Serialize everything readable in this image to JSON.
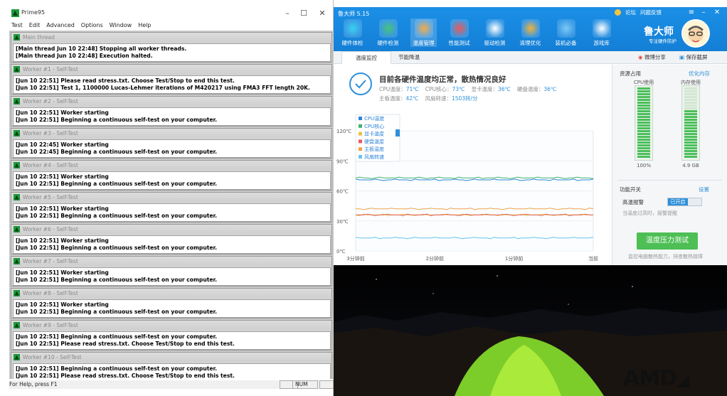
{
  "prime": {
    "title": "Prime95",
    "menu": [
      "Test",
      "Edit",
      "Advanced",
      "Options",
      "Window",
      "Help"
    ],
    "windows": [
      {
        "title": "Main thread",
        "lines": [
          "[Main thread Jun 10 22:48] Stopping all worker threads.",
          "[Main thread Jun 10 22:48] Execution halted."
        ]
      },
      {
        "title": "Worker #1 - Self-Test",
        "lines": [
          "[Jun 10 22:51] Please read stress.txt.  Choose Test/Stop to end this test.",
          "[Jun 10 22:51] Test 1, 1100000 Lucas-Lehmer iterations of M420217 using FMA3 FFT length 20K."
        ]
      },
      {
        "title": "Worker #2 - Self-Test",
        "lines": [
          "[Jun 10 22:51] Worker starting",
          "[Jun 10 22:51] Beginning a continuous self-test on your computer."
        ]
      },
      {
        "title": "Worker #3 - Self-Test",
        "lines": [
          "[Jun 10 22:45] Worker starting",
          "[Jun 10 22:45] Beginning a continuous self-test on your computer."
        ]
      },
      {
        "title": "Worker #4 - Self-Test",
        "lines": [
          "[Jun 10 22:51] Worker starting",
          "[Jun 10 22:51] Beginning a continuous self-test on your computer."
        ]
      },
      {
        "title": "Worker #5 - Self-Test",
        "lines": [
          "[Jun 10 22:51] Worker starting",
          "[Jun 10 22:51] Beginning a continuous self-test on your computer."
        ]
      },
      {
        "title": "Worker #6 - Self-Test",
        "lines": [
          "[Jun 10 22:51] Worker starting",
          "[Jun 10 22:51] Beginning a continuous self-test on your computer."
        ]
      },
      {
        "title": "Worker #7 - Self-Test",
        "lines": [
          "[Jun 10 22:51] Worker starting",
          "[Jun 10 22:51] Beginning a continuous self-test on your computer."
        ]
      },
      {
        "title": "Worker #8 - Self-Test",
        "lines": [
          "[Jun 10 22:51] Worker starting",
          "[Jun 10 22:51] Beginning a continuous self-test on your computer."
        ]
      },
      {
        "title": "Worker #9 - Self-Test",
        "lines": [
          "[Jun 10 22:51] Beginning a continuous self-test on your computer.",
          "[Jun 10 22:51] Please read stress.txt.  Choose Test/Stop to end this test."
        ]
      },
      {
        "title": "Worker #10 - Self-Test",
        "lines": [
          "[Jun 10 22:51] Beginning a continuous self-test on your computer.",
          "[Jun 10 22:51] Please read stress.txt.  Choose Test/Stop to end this test."
        ]
      }
    ],
    "status_help": "For Help, press F1",
    "status_num": "NUM"
  },
  "lds": {
    "title": "鲁大师 5.15",
    "tabs": [
      "硬件体检",
      "硬件检测",
      "温度管理",
      "性能测试",
      "驱动检测",
      "清理优化",
      "装机必备",
      "游戏库"
    ],
    "active_tab": 2,
    "top_links": [
      "论坛",
      "问题反馈"
    ],
    "brand": "鲁大师",
    "slogan": "专注硬件防护",
    "subtabs": [
      "温度监控",
      "节能降温"
    ],
    "share": "微博分享",
    "save": "保存截屏",
    "status_main": "目前各硬件温度均正常，散热情况良好",
    "stats_row1": [
      {
        "label": "CPU温度：",
        "value": "71℃"
      },
      {
        "label": "CPU核心：",
        "value": "73℃"
      },
      {
        "label": "显卡温度：",
        "value": "36℃"
      },
      {
        "label": "硬盘温度：",
        "value": "36℃"
      }
    ],
    "stats_row2": [
      {
        "label": "主板温度：",
        "value": "42℃"
      },
      {
        "label": "风扇转速：",
        "value": "1503转/分"
      }
    ],
    "right": {
      "resource_title": "资源占用",
      "optimize_link": "优化内存",
      "cpu_label": "CPU使用",
      "cpu_value": "100%",
      "cpu_level": 1.0,
      "mem_label": "内存使用",
      "mem_value": "4.9 GB",
      "mem_level": 0.67,
      "func_title": "功能开关",
      "settings_link": "设置",
      "alarm_label": "高温报警",
      "alarm_state": "已开启",
      "alarm_hint": "当温度过高时，报警提醒",
      "stress_button": "温度压力测试",
      "stress_hint": "监控电脑散热能力，排查散热故障"
    }
  },
  "chart_data": {
    "type": "line",
    "legend": [
      "CPU温度",
      "CPU核心",
      "显卡温度",
      "硬盘温度",
      "主板温度",
      "风扇转速"
    ],
    "colors": [
      "#2f84d9",
      "#3fb26e",
      "#e8c13a",
      "#e25c5c",
      "#f0a24a",
      "#66c6e8"
    ],
    "y_ticks": [
      "120℃",
      "90℃",
      "60℃",
      "30℃",
      "0℃"
    ],
    "ylim": [
      0,
      120
    ],
    "x_ticks": [
      "3分钟前",
      "2分钟前",
      "1分钟前",
      "当前"
    ],
    "series": [
      {
        "name": "CPU温度",
        "level": 71
      },
      {
        "name": "CPU核心",
        "level": 73
      },
      {
        "name": "显卡温度",
        "level": 36
      },
      {
        "name": "硬盘温度",
        "level": 36
      },
      {
        "name": "主板温度",
        "level": 42
      },
      {
        "name": "风扇转速",
        "level": 13
      }
    ]
  },
  "wallpaper": {
    "logo": "AMD"
  }
}
